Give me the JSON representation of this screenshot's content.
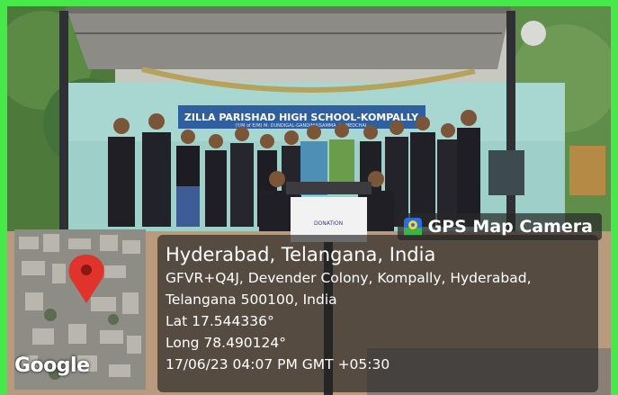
{
  "photo": {
    "school_banner": "ZILLA PARISHAD HIGH SCHOOL-KOMPALLY",
    "school_banner_sub": "(Y/M of E/M) M: DUNDIGAL-GANDIMAISAMMA, D: MEDCHAL",
    "placard_text": "DONATION"
  },
  "gps_overlay": {
    "badge_label": "GPS Map Camera",
    "map_provider": "Google",
    "location_title": "Hyderabad, Telangana, India",
    "address_line1": "GFVR+Q4J, Devender Colony, Kompally, Hyderabad,",
    "address_line2": "Telangana 500100, India",
    "latitude": "Lat 17.544336°",
    "longitude": "Long 78.490124°",
    "timestamp": "17/06/23 04:07 PM GMT +05:30"
  },
  "colors": {
    "frame_border": "#46e84a",
    "banner_bg": "#2f5f9e",
    "map_pin": "#e0332b",
    "overlay_bg": "rgba(35,35,35,0.66)"
  }
}
